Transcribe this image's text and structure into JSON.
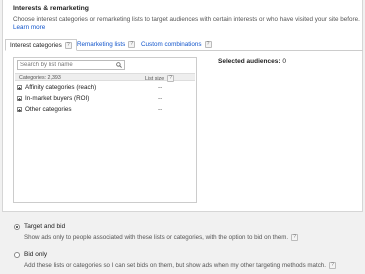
{
  "section": {
    "heading": "Interests & remarketing",
    "description": "Choose interest categories or remarketing lists to target audiences with certain interests or who have visited your site before.",
    "learn_more": "Learn more"
  },
  "tabs": [
    {
      "label": "Interest categories",
      "help": "?"
    },
    {
      "label": "Remarketing lists",
      "help": "?"
    },
    {
      "label": "Custom combinations",
      "help": "?"
    }
  ],
  "search": {
    "placeholder": "Search by list name"
  },
  "list": {
    "count_label": "Categories: 2,393",
    "size_header": "List size",
    "help": "?",
    "rows": [
      {
        "label": "Affinity categories (reach)",
        "size": "--"
      },
      {
        "label": "In-market buyers (ROI)",
        "size": "--"
      },
      {
        "label": "Other categories",
        "size": "--"
      }
    ]
  },
  "selected": {
    "label": "Selected audiences:",
    "count": "0"
  },
  "options": {
    "target_and_bid": {
      "label": "Target and bid",
      "description": "Show ads only to people associated with these lists or categories, with the option to bid on them.",
      "help": "?",
      "selected": true
    },
    "bid_only": {
      "label": "Bid only",
      "description": "Add these lists or categories so I can set bids on them, but show ads when my other targeting methods match.",
      "help": "?",
      "selected": false
    }
  },
  "colors": {
    "link": "#1155cc",
    "border": "#cccccc",
    "background": "#f1f1f1"
  }
}
